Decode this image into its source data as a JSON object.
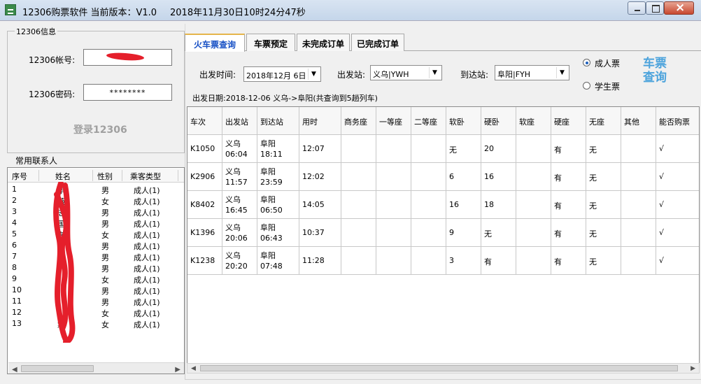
{
  "window": {
    "title": "12306购票软件  当前版本：V1.0",
    "datetime": "2018年11月30日10时24分47秒"
  },
  "account_group": {
    "title": "12306信息",
    "account_label": "12306帐号:",
    "password_label": "12306密码:",
    "password_value": "********",
    "login_label": "登录12306"
  },
  "contacts": {
    "title": "常用联系人",
    "headers": [
      "序号",
      "姓名",
      "性别",
      "乘客类型"
    ],
    "rows": [
      {
        "index": "1",
        "name": "华",
        "gender": "男",
        "type": "成人(1)"
      },
      {
        "index": "2",
        "name": "薇",
        "gender": "女",
        "type": "成人(1)"
      },
      {
        "index": "3",
        "name": "志",
        "gender": "男",
        "type": "成人(1)"
      },
      {
        "index": "4",
        "name": "国",
        "gender": "男",
        "type": "成人(1)"
      },
      {
        "index": "5",
        "name": "海",
        "gender": "女",
        "type": "成人(1)"
      },
      {
        "index": "6",
        "name": "",
        "gender": "男",
        "type": "成人(1)"
      },
      {
        "index": "7",
        "name": "",
        "gender": "男",
        "type": "成人(1)"
      },
      {
        "index": "8",
        "name": "",
        "gender": "男",
        "type": "成人(1)"
      },
      {
        "index": "9",
        "name": "",
        "gender": "女",
        "type": "成人(1)"
      },
      {
        "index": "10",
        "name": "",
        "gender": "男",
        "type": "成人(1)"
      },
      {
        "index": "11",
        "name": "",
        "gender": "男",
        "type": "成人(1)"
      },
      {
        "index": "12",
        "name": "",
        "gender": "女",
        "type": "成人(1)"
      },
      {
        "index": "13",
        "name": "霜",
        "gender": "女",
        "type": "成人(1)"
      }
    ]
  },
  "tabs": [
    "火车票查询",
    "车票预定",
    "未完成订单",
    "已完成订单"
  ],
  "query": {
    "depart_time_label": "出发时间:",
    "depart_date": "2018年12月 6日",
    "from_label": "出发站:",
    "from_value": "义乌|YWH",
    "to_label": "到达站:",
    "to_value": "阜阳|FYH",
    "ticket_types": [
      "成人票",
      "学生票"
    ],
    "query_button": [
      "车票",
      "查询"
    ],
    "info": "出发日期:2018-12-06   义乌->阜阳(共查询到5趟列车)"
  },
  "trains": {
    "headers": [
      "车次",
      "出发站",
      "到达站",
      "用时",
      "商务座",
      "一等座",
      "二等座",
      "软卧",
      "硬卧",
      "软座",
      "硬座",
      "无座",
      "其他",
      "能否购票"
    ],
    "rows": [
      {
        "no": "K1050",
        "from": "义乌",
        "from_time": "06:04",
        "to": "阜阳",
        "to_time": "18:11",
        "duration": "12:07",
        "business": "",
        "first": "",
        "second": "",
        "soft_sleeper": "无",
        "hard_sleeper": "20",
        "soft_seat": "",
        "hard_seat": "有",
        "no_seat": "无",
        "other": "",
        "can_buy": "√"
      },
      {
        "no": "K2906",
        "from": "义乌",
        "from_time": "11:57",
        "to": "阜阳",
        "to_time": "23:59",
        "duration": "12:02",
        "business": "",
        "first": "",
        "second": "",
        "soft_sleeper": "6",
        "hard_sleeper": "16",
        "soft_seat": "",
        "hard_seat": "有",
        "no_seat": "无",
        "other": "",
        "can_buy": "√"
      },
      {
        "no": "K8402",
        "from": "义乌",
        "from_time": "16:45",
        "to": "阜阳",
        "to_time": "06:50",
        "duration": "14:05",
        "business": "",
        "first": "",
        "second": "",
        "soft_sleeper": "16",
        "hard_sleeper": "18",
        "soft_seat": "",
        "hard_seat": "有",
        "no_seat": "无",
        "other": "",
        "can_buy": "√"
      },
      {
        "no": "K1396",
        "from": "义乌",
        "from_time": "20:06",
        "to": "阜阳",
        "to_time": "06:43",
        "duration": "10:37",
        "business": "",
        "first": "",
        "second": "",
        "soft_sleeper": "9",
        "hard_sleeper": "无",
        "soft_seat": "",
        "hard_seat": "有",
        "no_seat": "无",
        "other": "",
        "can_buy": "√"
      },
      {
        "no": "K1238",
        "from": "义乌",
        "from_time": "20:20",
        "to": "阜阳",
        "to_time": "07:48",
        "duration": "11:28",
        "business": "",
        "first": "",
        "second": "",
        "soft_sleeper": "3",
        "hard_sleeper": "有",
        "soft_seat": "",
        "hard_seat": "有",
        "no_seat": "无",
        "other": "",
        "can_buy": "√"
      }
    ]
  },
  "colors": {
    "tab_active": "#1750c5",
    "redaction": "#e51f2b",
    "query_button": "#4ca3dc"
  }
}
